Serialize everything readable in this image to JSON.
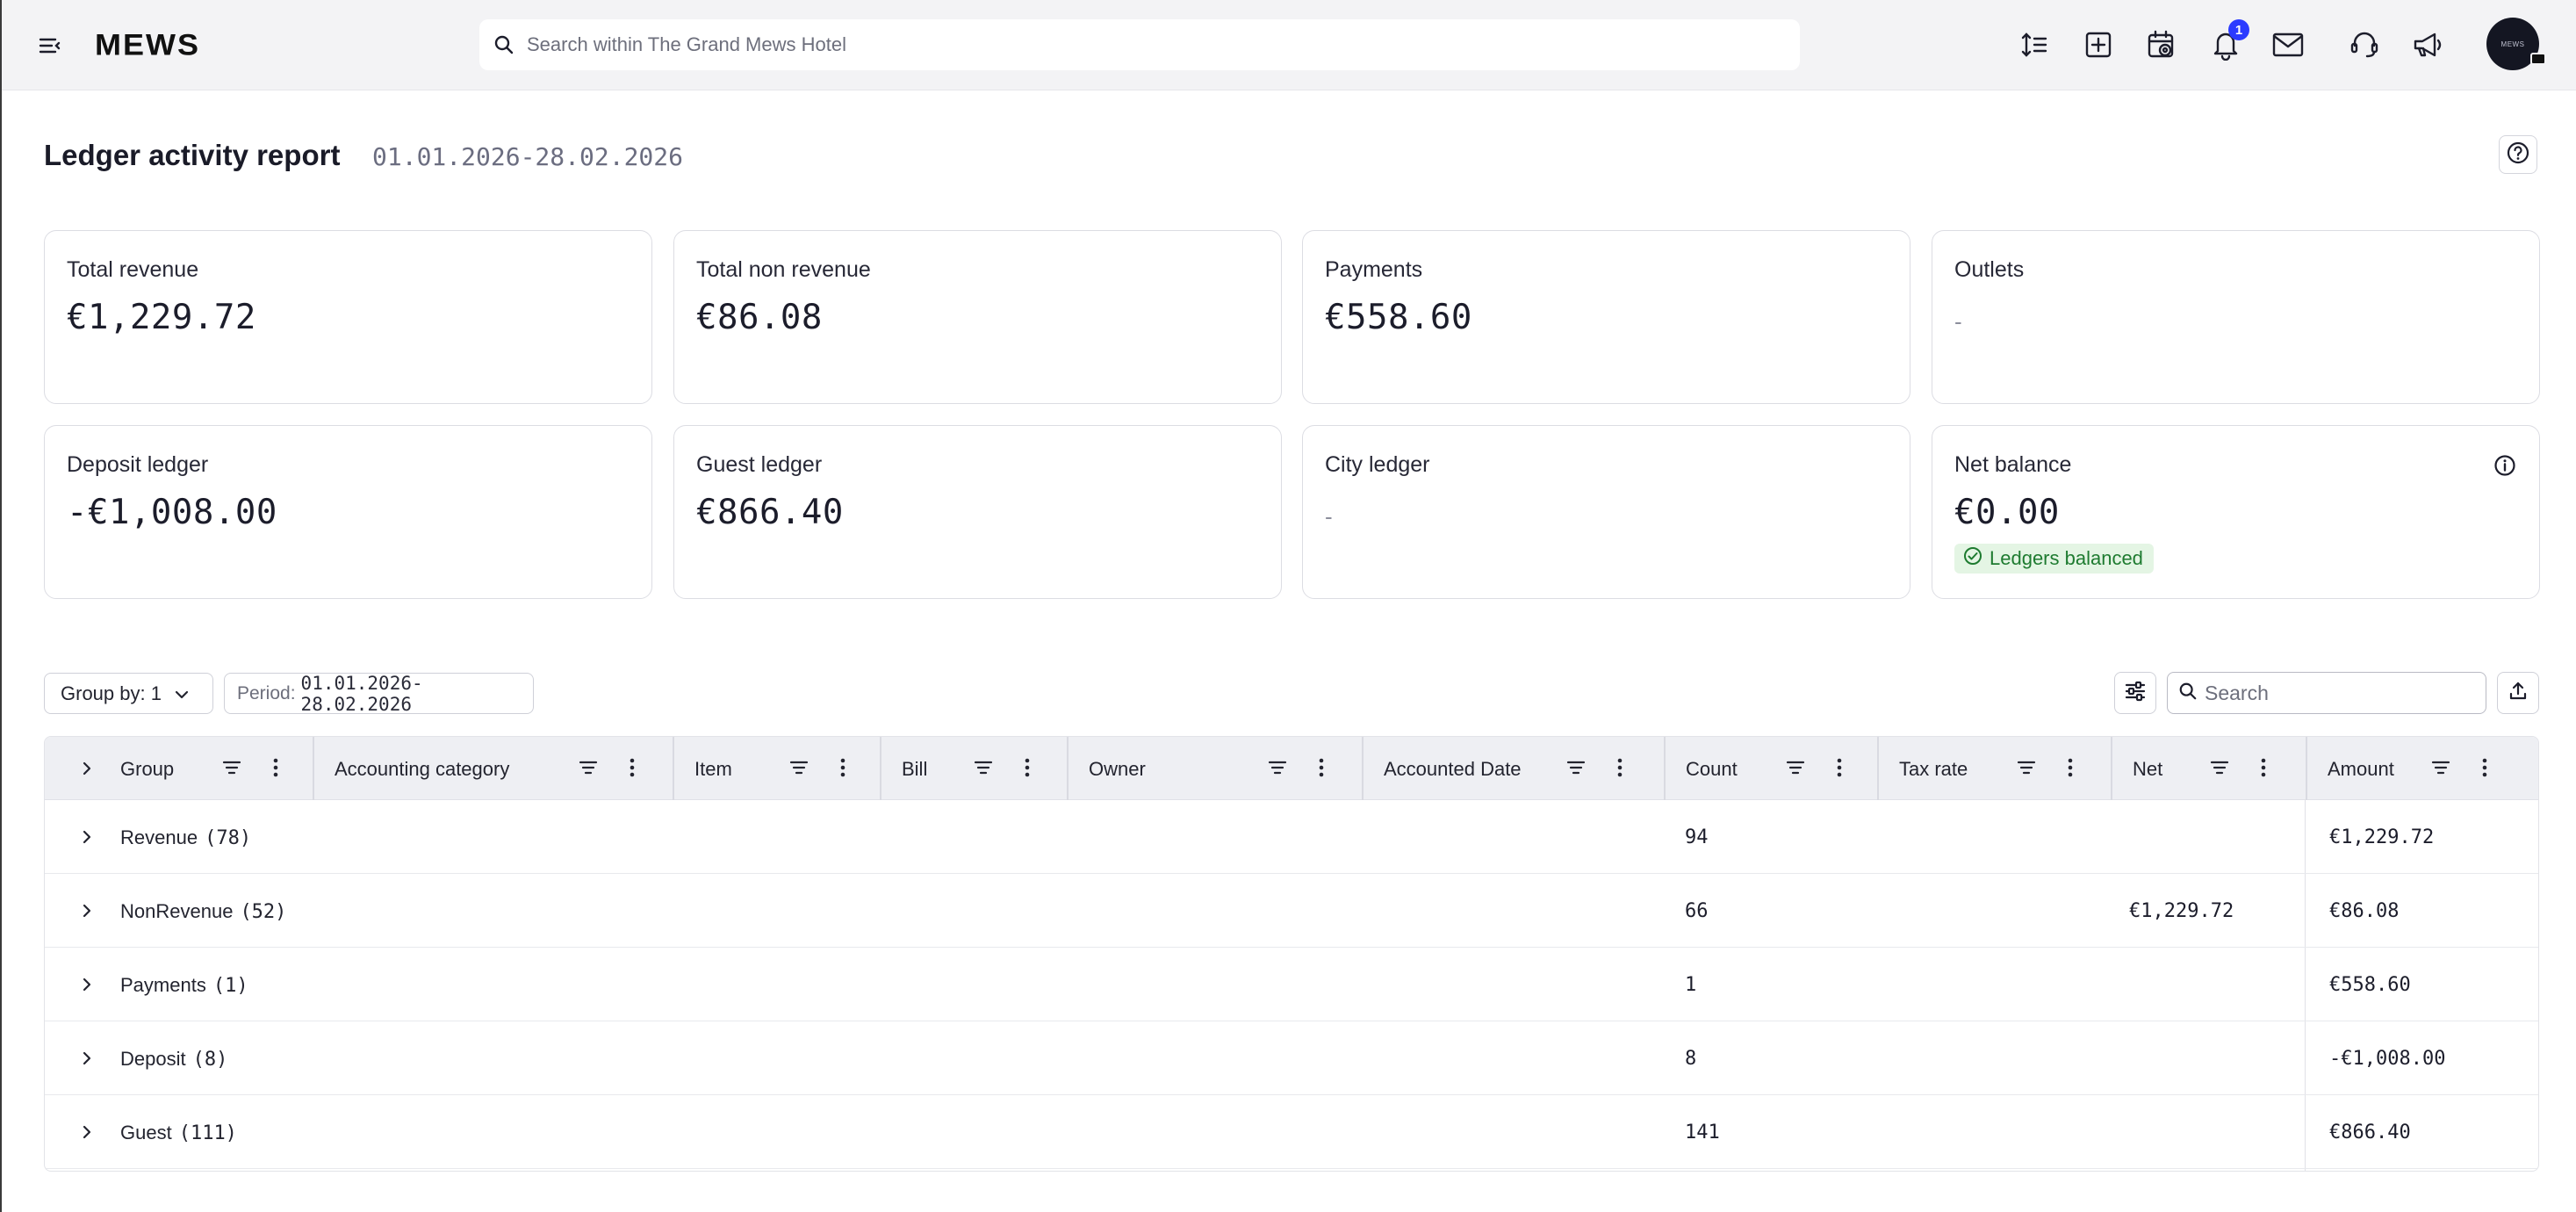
{
  "topbar": {
    "logo": "MEWS",
    "search_placeholder": "Search within The Grand Mews Hotel",
    "notification_count": "1",
    "avatar_text": "MEWS",
    "icons": [
      "menu-icon",
      "density-icon",
      "add-icon",
      "calendar-icon",
      "bell-icon",
      "mail-icon",
      "support-icon",
      "megaphone-icon"
    ]
  },
  "header": {
    "title": "Ledger activity report",
    "period": "01.01.2026-28.02.2026"
  },
  "cards": {
    "total_revenue": {
      "label": "Total revenue",
      "value": "€1,229.72"
    },
    "total_non_revenue": {
      "label": "Total non revenue",
      "value": "€86.08"
    },
    "payments": {
      "label": "Payments",
      "value": "€558.60"
    },
    "outlets": {
      "label": "Outlets",
      "value": "-"
    },
    "deposit_ledger": {
      "label": "Deposit ledger",
      "value": "-€1,008.00"
    },
    "guest_ledger": {
      "label": "Guest ledger",
      "value": "€866.40"
    },
    "city_ledger": {
      "label": "City ledger",
      "value": "-"
    },
    "net_balance": {
      "label": "Net balance",
      "value": "€0.00",
      "status": "Ledgers balanced"
    }
  },
  "toolbar": {
    "group_by": "Group by: 1",
    "period_label": "Period:",
    "period_value": "01.01.2026-28.02.2026",
    "search_placeholder": "Search"
  },
  "table": {
    "columns": [
      "Group",
      "Accounting category",
      "Item",
      "Bill",
      "Owner",
      "Accounted Date",
      "Count",
      "Tax rate",
      "Net",
      "Amount"
    ],
    "rows": [
      {
        "group": "Revenue",
        "n": "(78)",
        "count": "94",
        "net": "",
        "amount": "€1,229.72"
      },
      {
        "group": "NonRevenue",
        "n": "(52)",
        "count": "66",
        "net": "€1,229.72",
        "amount": "€86.08"
      },
      {
        "group": "Payments",
        "n": "(1)",
        "count": "1",
        "net": "",
        "amount": "€558.60"
      },
      {
        "group": "Deposit",
        "n": "(8)",
        "count": "8",
        "net": "",
        "amount": "-€1,008.00"
      },
      {
        "group": "Guest",
        "n": "(111)",
        "count": "141",
        "net": "",
        "amount": "€866.40"
      }
    ]
  },
  "colors": {
    "accent_badge": "#2b3bff",
    "balanced_bg": "#e4f5e4",
    "balanced_text": "#1e7b30",
    "header_bg": "#eeeff3"
  }
}
